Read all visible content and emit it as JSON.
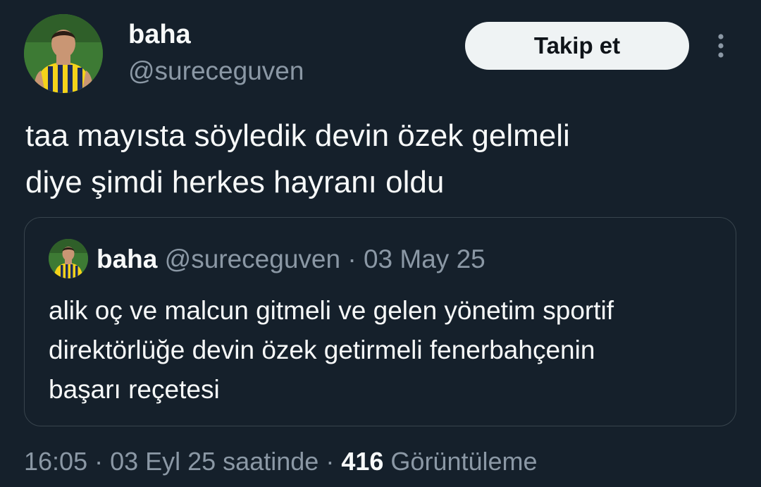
{
  "author": {
    "name": "baha",
    "handle": "@sureceguven"
  },
  "follow_button": {
    "label": "Takip et"
  },
  "tweet": {
    "line1": "taa mayısta söyledik devin özek gelmeli",
    "line2": "diye şimdi herkes hayranı oldu"
  },
  "quote": {
    "name": "baha",
    "handle": "@sureceguven",
    "separator": "·",
    "date": "03 May 25",
    "line1": "alik oç ve malcun gitmeli ve gelen yönetim sportif",
    "line2": "direktörlüğe devin özek getirmeli fenerbahçenin",
    "line3": "başarı reçetesi"
  },
  "footer": {
    "timestamp": "16:05 · 03 Eyl 25 saatinde",
    "separator": "·",
    "views_count": "416",
    "views_label": "Görüntüleme"
  },
  "colors": {
    "background": "#15202b",
    "text_primary": "#f7f9f9",
    "text_secondary": "#8b98a5",
    "border": "#38444d",
    "button_background": "#eff3f4",
    "button_text": "#0f1419"
  },
  "icons": {
    "more": "more-vertical-icon"
  }
}
